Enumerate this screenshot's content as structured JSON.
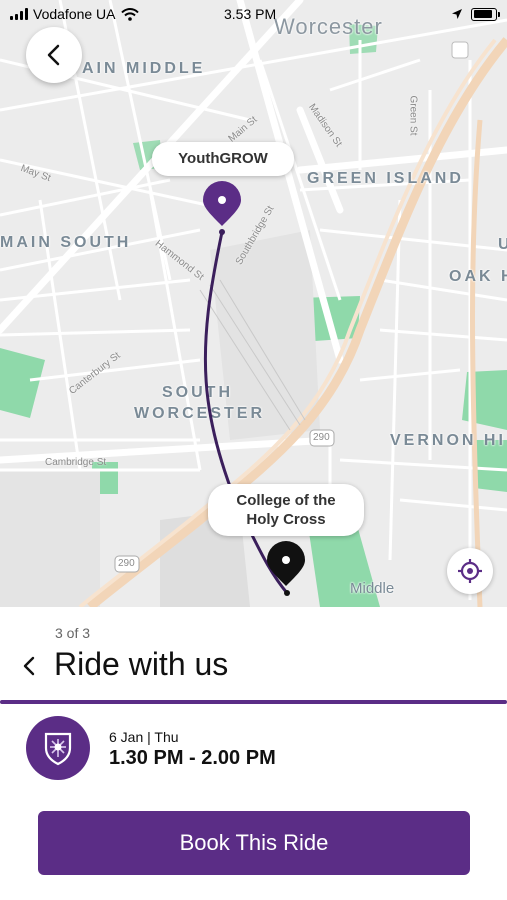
{
  "status_bar": {
    "carrier": "Vodafone UA",
    "time": "3.53 PM",
    "icons": [
      "signal-icon",
      "wifi-icon",
      "location-arrow-icon",
      "battery-icon"
    ],
    "battery_level": 0.9
  },
  "map": {
    "areas": {
      "worcester": "Worcester",
      "main_middle": "AIN MIDDLE",
      "green_island": "GREEN ISLAND",
      "main_south": "MAIN SOUTH",
      "oak_hill": "OAK H",
      "south": "SOUTH",
      "worcester2": "WORCESTER",
      "vernon_hill": "VERNON HI",
      "middle": "Middle",
      "edge_u": "U"
    },
    "streets": {
      "may": "May St",
      "main": "Main St",
      "madison": "Madison St",
      "green": "Green St",
      "hammond": "Hammond St",
      "southbridge": "Southbridge St",
      "canterbury": "Canterbury St",
      "cambridge": "Cambridge St"
    },
    "highway_shields": {
      "a": "290",
      "b": "290"
    },
    "pickup_label": "YouthGROW",
    "dropoff_label_line1": "College of the",
    "dropoff_label_line2": "Holy Cross",
    "route_color": "#3b1f5c",
    "pin_purple": "#5b2d86",
    "pin_black": "#111111"
  },
  "sheet": {
    "step": "3 of 3",
    "title": "Ride with us",
    "ride": {
      "date": "6 Jan | Thu",
      "time": "1.30 PM - 2.00 PM"
    },
    "book_button": "Book This Ride",
    "accent": "#5b2d86"
  }
}
